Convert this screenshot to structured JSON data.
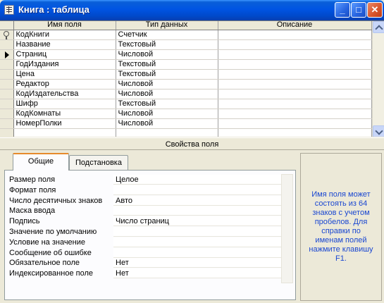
{
  "window": {
    "title": "Книга : таблица"
  },
  "grid": {
    "headers": [
      "Имя поля",
      "Тип данных",
      "Описание"
    ],
    "rows": [
      {
        "name": "КодКниги",
        "type": "Счетчик",
        "desc": "",
        "key": true
      },
      {
        "name": "Название",
        "type": "Текстовый",
        "desc": ""
      },
      {
        "name": "Страниц",
        "type": "Числовой",
        "desc": "",
        "current": true
      },
      {
        "name": "ГодИздания",
        "type": "Текстовый",
        "desc": ""
      },
      {
        "name": "Цена",
        "type": "Текстовый",
        "desc": ""
      },
      {
        "name": "Редактор",
        "type": "Числовой",
        "desc": ""
      },
      {
        "name": "КодИздательства",
        "type": "Числовой",
        "desc": ""
      },
      {
        "name": "Шифр",
        "type": "Текстовый",
        "desc": ""
      },
      {
        "name": "КодКомнаты",
        "type": "Числовой",
        "desc": ""
      },
      {
        "name": "НомерПолки",
        "type": "Числовой",
        "desc": ""
      }
    ]
  },
  "properties": {
    "caption": "Свойства поля",
    "tabs": [
      "Общие",
      "Подстановка"
    ],
    "active_tab": "Общие",
    "items": [
      {
        "label": "Размер поля",
        "value": "Целое"
      },
      {
        "label": "Формат поля",
        "value": ""
      },
      {
        "label": "Число десятичных знаков",
        "value": "Авто"
      },
      {
        "label": "Маска ввода",
        "value": ""
      },
      {
        "label": "Подпись",
        "value": "Число страниц"
      },
      {
        "label": "Значение по умолчанию",
        "value": ""
      },
      {
        "label": "Условие на значение",
        "value": ""
      },
      {
        "label": "Сообщение об ошибке",
        "value": ""
      },
      {
        "label": "Обязательное поле",
        "value": "Нет"
      },
      {
        "label": "Индексированное поле",
        "value": "Нет"
      }
    ]
  },
  "help": {
    "text": "Имя поля может состоять из 64 знаков с учетом пробелов.  Для справки по именам полей нажмите клавишу F1."
  },
  "colors": {
    "titlebar": "#0054e3",
    "help_text": "#1a47d1",
    "tab_highlight": "#e68b2c"
  },
  "icons": {
    "window": "table-icon",
    "primary_key": "key-icon",
    "current_row": "row-pointer-icon"
  }
}
